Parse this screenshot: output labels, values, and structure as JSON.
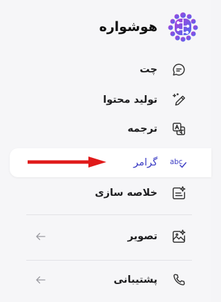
{
  "app": {
    "title": "هوشواره",
    "logo_icon": "brain-logo-icon"
  },
  "menu": {
    "items": [
      {
        "key": "chat",
        "label": "چت",
        "icon": "chat-bubble-icon"
      },
      {
        "key": "content",
        "label": "تولید محتوا",
        "icon": "pen-sparkle-icon"
      },
      {
        "key": "translate",
        "label": "ترجمه",
        "icon": "translate-icon"
      },
      {
        "key": "grammar",
        "label": "گرامر",
        "icon": "spellcheck-icon",
        "active": true
      },
      {
        "key": "summary",
        "label": "خلاصه سازی",
        "icon": "summary-sparkle-icon"
      },
      {
        "key": "image",
        "label": "تصویر",
        "icon": "image-sparkle-icon",
        "expandable": true
      },
      {
        "key": "support",
        "label": "پشتیبانی",
        "icon": "phone-icon",
        "expandable": true
      }
    ]
  },
  "colors": {
    "accent": "#3b3cc4",
    "pointer_arrow": "#e01a1a",
    "logo_primary": "#8b3fd9",
    "logo_secondary": "#4a6cf0"
  }
}
